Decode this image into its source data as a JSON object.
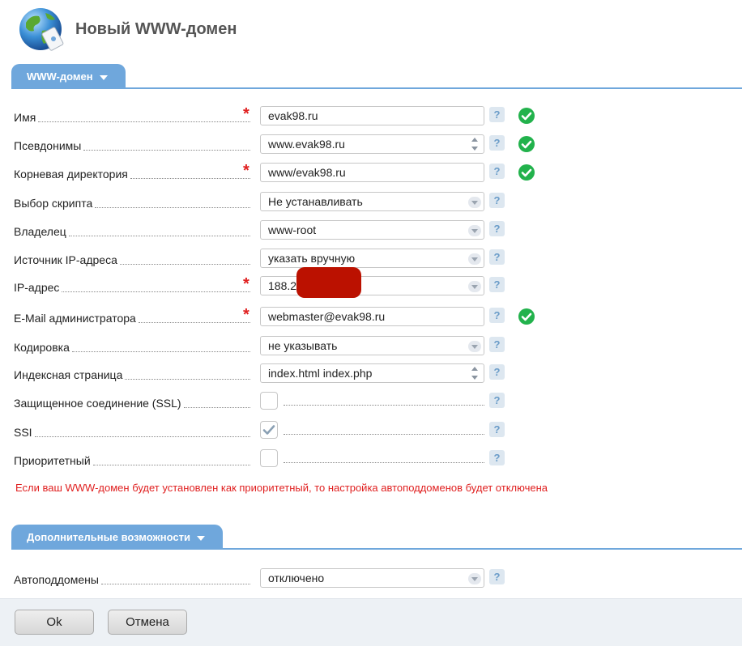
{
  "page": {
    "title": "Новый WWW-домен",
    "logo_icon": "globe-card-icon"
  },
  "sections": [
    {
      "label": "WWW-домен"
    },
    {
      "label": "Дополнительные возможности"
    }
  ],
  "fields": {
    "name": {
      "label": "Имя",
      "value": "evak98.ru"
    },
    "aliases": {
      "label": "Псевдонимы",
      "value": "www.evak98.ru"
    },
    "root_dir": {
      "label": "Корневая директория",
      "value": "www/evak98.ru"
    },
    "script": {
      "label": "Выбор скрипта",
      "value": "Не устанавливать"
    },
    "owner": {
      "label": "Владелец",
      "value": "www-root"
    },
    "ip_source": {
      "label": "Источник IP-адреса",
      "value": "указать вручную"
    },
    "ip": {
      "label": "IP-адрес",
      "value": "188.2"
    },
    "admin_email": {
      "label": "E-Mail администратора",
      "value": "webmaster@evak98.ru"
    },
    "encoding": {
      "label": "Кодировка",
      "value": "не указывать"
    },
    "index_page": {
      "label": "Индексная страница",
      "value": "index.html index.php"
    },
    "ssl": {
      "label": "Защищенное соединение (SSL)",
      "checked": false
    },
    "ssi": {
      "label": "SSI",
      "checked": true
    },
    "priority": {
      "label": "Приоритетный",
      "checked": false
    },
    "autosubdomains": {
      "label": "Автоподдомены",
      "value": "отключено"
    }
  },
  "warning": "Если ваш WWW-домен будет установлен как приоритетный, то настройка автоподдоменов будет отключена",
  "help_symbol": "?",
  "required_symbol": "*",
  "buttons": {
    "ok": "Ok",
    "cancel": "Отмена"
  },
  "colors": {
    "accent": "#6fa7dc",
    "valid": "#22b24c",
    "required": "#e02020",
    "redaction": "#bb1100"
  }
}
